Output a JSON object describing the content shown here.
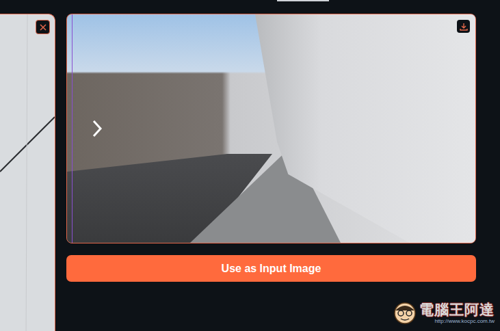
{
  "primary_button": {
    "label": "Use as Input Image"
  },
  "watermark": {
    "name": "電腦王阿達",
    "url": "http://www.kocpc.com.tw"
  }
}
